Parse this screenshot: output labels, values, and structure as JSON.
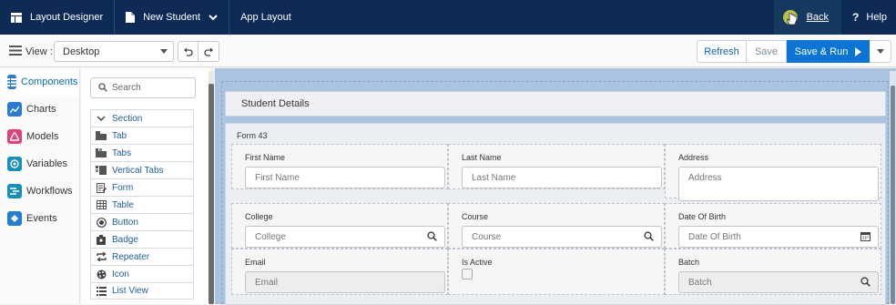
{
  "topbar": {
    "app_label": "Layout Designer",
    "page_label": "New Student",
    "app_layout_label": "App Layout",
    "back_label": "Back",
    "help_label": "Help",
    "help_symbol": "?"
  },
  "toolbar": {
    "view_label": "View :",
    "view_value": "Desktop",
    "refresh_label": "Refresh",
    "save_label": "Save",
    "save_run_label": "Save & Run"
  },
  "leftnav": {
    "items": [
      {
        "label": "Components",
        "icon": "components-icon",
        "color": "#2a7bd4"
      },
      {
        "label": "Charts",
        "icon": "chart-icon",
        "color": "#2a7bd4"
      },
      {
        "label": "Models",
        "icon": "models-icon",
        "color": "#e0407a"
      },
      {
        "label": "Variables",
        "icon": "variables-icon",
        "color": "#1a8fb8"
      },
      {
        "label": "Workflows",
        "icon": "workflow-icon",
        "color": "#1a8fb8"
      },
      {
        "label": "Events",
        "icon": "events-icon",
        "color": "#2a7bd4"
      }
    ]
  },
  "components": {
    "search_placeholder": "Search",
    "items": [
      {
        "label": "Section",
        "icon": "chevron-down-icon"
      },
      {
        "label": "Tab",
        "icon": "tab-icon"
      },
      {
        "label": "Tabs",
        "icon": "tabs-icon"
      },
      {
        "label": "Vertical Tabs",
        "icon": "vertical-tabs-icon"
      },
      {
        "label": "Form",
        "icon": "form-icon"
      },
      {
        "label": "Table",
        "icon": "table-icon"
      },
      {
        "label": "Button",
        "icon": "button-icon"
      },
      {
        "label": "Badge",
        "icon": "badge-icon"
      },
      {
        "label": "Repeater",
        "icon": "repeater-icon"
      },
      {
        "label": "Icon",
        "icon": "palette-icon"
      },
      {
        "label": "List View",
        "icon": "list-view-icon"
      }
    ]
  },
  "canvas": {
    "section_title": "Student Details",
    "form_title": "Form 43",
    "fields": {
      "first_name": {
        "label": "First Name",
        "placeholder": "First Name"
      },
      "last_name": {
        "label": "Last Name",
        "placeholder": "Last Name"
      },
      "address": {
        "label": "Address",
        "placeholder": "Address"
      },
      "college": {
        "label": "College",
        "placeholder": "College"
      },
      "course": {
        "label": "Course",
        "placeholder": "Course"
      },
      "dob": {
        "label": "Date Of Birth",
        "placeholder": "Date Of Birth"
      },
      "email": {
        "label": "Email",
        "placeholder": "Email"
      },
      "is_active": {
        "label": "Is Active"
      },
      "batch": {
        "label": "Batch",
        "placeholder": "Batch"
      }
    }
  }
}
